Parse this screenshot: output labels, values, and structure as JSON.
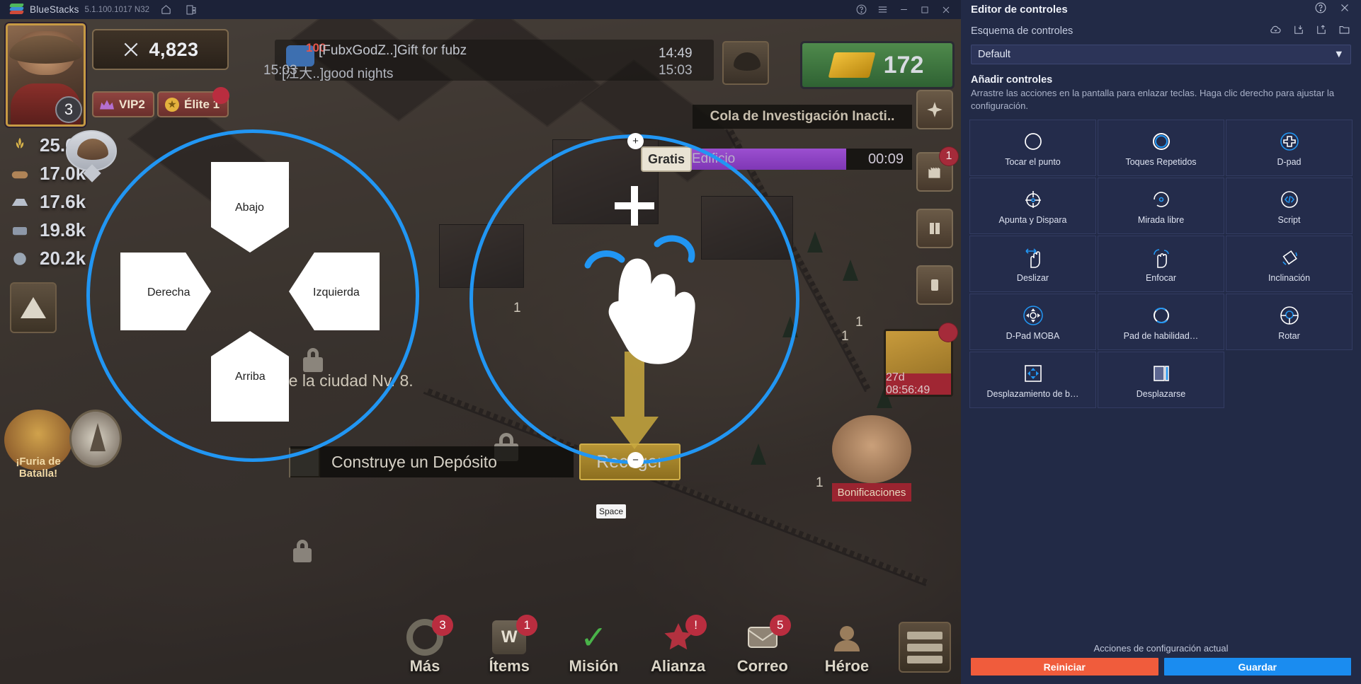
{
  "titlebar": {
    "app_name": "BlueStacks",
    "version": "5.1.100.1017 N32",
    "home_icon": "home-icon",
    "multi_instance_icon": "multi-instance-icon",
    "help_icon": "help-icon",
    "menu_icon": "hamburger-menu-icon",
    "minimize_icon": "minimize-icon",
    "maximize_icon": "maximize-icon",
    "close_icon": "close-icon"
  },
  "game": {
    "avatar_level": "3",
    "power": "4,823",
    "vip": "VIP2",
    "elite": "Élite 1",
    "gold": "172",
    "resources": [
      "25.6k",
      "17.0k",
      "17.6k",
      "19.8k",
      "20.2k"
    ],
    "chat": {
      "line1": "[FubxGodZ..]Gift for fubz",
      "line2": "[江大..]good  nights",
      "count": "100",
      "time1": "14:49",
      "time2": "15:03",
      "time_left": "15:03"
    },
    "research_queue_title": "Cola de Investigación Inacti..",
    "research_queue_label": "Edificio",
    "research_queue_time": "00:09",
    "free_button": "Gratis",
    "city_label": "ro de la ciudad Nv. 8.",
    "construct_banner": "Construye un Depósito",
    "collect_button": "Recoger",
    "gift_timer": "27d 08:56:49",
    "bonus_label": "Bonificaciones",
    "battle_label": "¡Furia de Batalla!",
    "plot_numbers": [
      "1",
      "1",
      "1",
      "1",
      "1"
    ],
    "bottom_nav": [
      {
        "label": "Más",
        "badge": "3",
        "icon": "gear-icon"
      },
      {
        "label": "Ítems",
        "badge": "1",
        "icon": "bag-icon"
      },
      {
        "label": "Misión",
        "badge": "",
        "icon": "check-icon"
      },
      {
        "label": "Alianza",
        "badge": "!",
        "icon": "star-icon"
      },
      {
        "label": "Correo",
        "badge": "5",
        "icon": "mail-icon"
      },
      {
        "label": "Héroe",
        "badge": "",
        "icon": "hero-icon"
      }
    ],
    "menu_button_icon": "list-menu-icon"
  },
  "overlay": {
    "dpad": {
      "up_label": "Arriba",
      "down_label": "Abajo",
      "left_label": "Izquierda",
      "right_label": "Derecha"
    },
    "scroll_control": {
      "plus": "+",
      "minus": "−",
      "hand_icon": "hand-drag-icon",
      "crosshair_icon": "crosshair-icon",
      "arrow_icon": "down-arrow-icon"
    },
    "space_key": "Space",
    "accent": "#2196f3"
  },
  "panel": {
    "title": "Editor de controles",
    "help_icon": "help-circle-icon",
    "close_icon": "close-icon",
    "scheme_label": "Esquema de controles",
    "scheme_icons": [
      "cloud-sync-icon",
      "import-icon",
      "export-icon",
      "folder-icon"
    ],
    "scheme_value": "Default",
    "add_title": "Añadir controles",
    "add_desc": "Arrastre las acciones en la pantalla para enlazar teclas. Haga clic derecho para ajustar la configuración.",
    "controls": [
      {
        "label": "Tocar el punto",
        "icon": "tap-circle-icon"
      },
      {
        "label": "Toques Repetidos",
        "icon": "repeat-tap-icon"
      },
      {
        "label": "D-pad",
        "icon": "dpad-icon"
      },
      {
        "label": "Apunta y Dispara",
        "icon": "aim-shoot-icon"
      },
      {
        "label": "Mirada libre",
        "icon": "free-look-icon"
      },
      {
        "label": "Script",
        "icon": "script-icon"
      },
      {
        "label": "Deslizar",
        "icon": "swipe-icon"
      },
      {
        "label": "Enfocar",
        "icon": "focus-icon"
      },
      {
        "label": "Inclinación",
        "icon": "tilt-icon"
      },
      {
        "label": "D-Pad MOBA",
        "icon": "dpad-moba-icon"
      },
      {
        "label": "Pad de habilidad…",
        "icon": "skill-pad-icon"
      },
      {
        "label": "Rotar",
        "icon": "rotate-icon"
      },
      {
        "label": "Desplazamiento de b…",
        "icon": "scroll-pan-icon"
      },
      {
        "label": "Desplazarse",
        "icon": "scrollbar-icon"
      }
    ],
    "footer_label": "Acciones de configuración actual",
    "reset_button": "Reiniciar",
    "save_button": "Guardar",
    "reset_color": "#f05c3c",
    "save_color": "#1a8cf0"
  }
}
